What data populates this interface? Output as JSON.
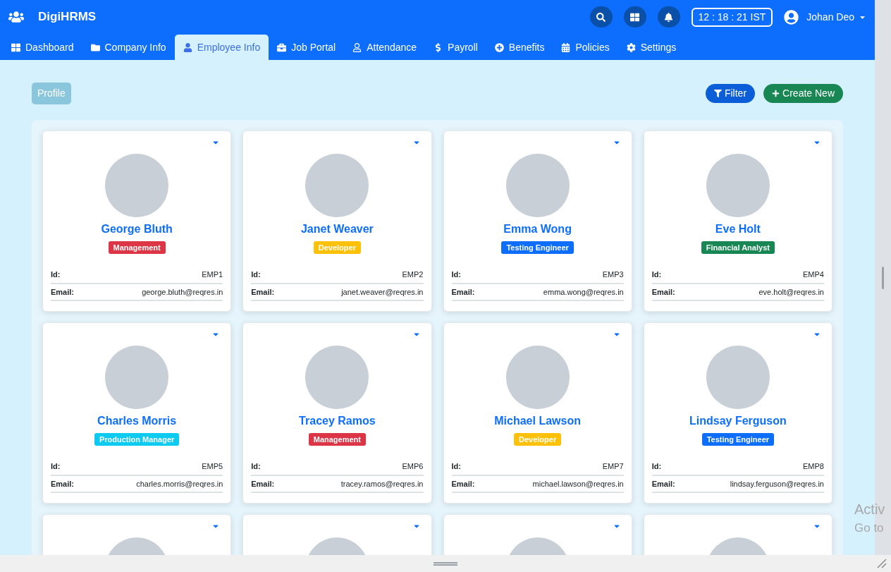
{
  "app": {
    "title": "DigiHRMS"
  },
  "header": {
    "clock": "12 : 18 : 21 IST",
    "user": "Johan Deo"
  },
  "tabs": [
    {
      "label": "Dashboard",
      "selected": false
    },
    {
      "label": "Company Info",
      "selected": false
    },
    {
      "label": "Employee Info",
      "selected": true
    },
    {
      "label": "Job Portal",
      "selected": false
    },
    {
      "label": "Attendance",
      "selected": false
    },
    {
      "label": "Payroll",
      "selected": false
    },
    {
      "label": "Benefits",
      "selected": false
    },
    {
      "label": "Policies",
      "selected": false
    },
    {
      "label": "Settings",
      "selected": false
    }
  ],
  "toolbar": {
    "section": "Profile",
    "filter": "Filter",
    "create": "Create New"
  },
  "employees": [
    {
      "kind": "full",
      "name": "George Bluth",
      "role": "Management",
      "color": "#dc3545",
      "id_label": "Id:",
      "id": "EMP1",
      "email_label": "Email:",
      "email": "george.bluth@reqres.in"
    },
    {
      "kind": "full",
      "name": "Janet Weaver",
      "role": "Developer",
      "color": "#ffc107",
      "id_label": "Id:",
      "id": "EMP2",
      "email_label": "Email:",
      "email": "janet.weaver@reqres.in"
    },
    {
      "kind": "full",
      "name": "Emma Wong",
      "role": "Testing Engineer",
      "color": "#0d6efd",
      "id_label": "Id:",
      "id": "EMP3",
      "email_label": "Email:",
      "email": "emma.wong@reqres.in"
    },
    {
      "kind": "full",
      "name": "Eve Holt",
      "role": "Financial Analyst",
      "color": "#198754",
      "id_label": "Id:",
      "id": "EMP4",
      "email_label": "Email:",
      "email": "eve.holt@reqres.in"
    },
    {
      "kind": "full",
      "name": "Charles Morris",
      "role": "Production Manager",
      "color": "#0dcaf0",
      "id_label": "Id:",
      "id": "EMP5",
      "email_label": "Email:",
      "email": "charles.morris@reqres.in"
    },
    {
      "kind": "full",
      "name": "Tracey Ramos",
      "role": "Management",
      "color": "#dc3545",
      "id_label": "Id:",
      "id": "EMP6",
      "email_label": "Email:",
      "email": "tracey.ramos@reqres.in"
    },
    {
      "kind": "full",
      "name": "Michael Lawson",
      "role": "Developer",
      "color": "#ffc107",
      "id_label": "Id:",
      "id": "EMP7",
      "email_label": "Email:",
      "email": "michael.lawson@reqres.in"
    },
    {
      "kind": "full",
      "name": "Lindsay Ferguson",
      "role": "Testing Engineer",
      "color": "#0d6efd",
      "id_label": "Id:",
      "id": "EMP8",
      "email_label": "Email:",
      "email": "lindsay.ferguson@reqres.in"
    },
    {
      "kind": "partial"
    },
    {
      "kind": "partial"
    },
    {
      "kind": "partial"
    },
    {
      "kind": "partial"
    }
  ],
  "overlay": {
    "line_1": "Activ",
    "line_2": "Go to"
  }
}
